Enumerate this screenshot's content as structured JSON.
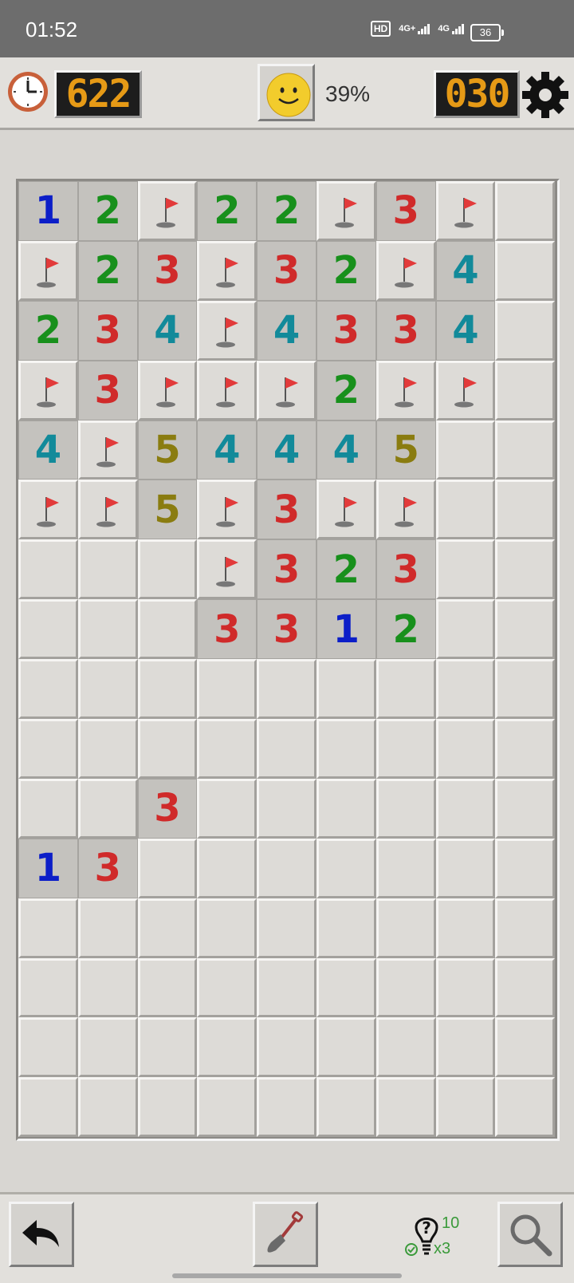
{
  "status_bar": {
    "time": "01:52",
    "hd": "HD",
    "net1": "4G+",
    "net2": "4G",
    "battery": "36"
  },
  "header": {
    "timer": "622",
    "progress": "39%",
    "mines_left": "030",
    "timer_icon": "clock-icon",
    "face_icon": "smiley-icon",
    "settings_icon": "gear-icon"
  },
  "board": {
    "columns": 9,
    "rows": [
      [
        "1",
        "2",
        "F",
        "2",
        "2",
        "F",
        "3",
        "F",
        ""
      ],
      [
        "F",
        "2",
        "3",
        "F",
        "3",
        "2",
        "F",
        "4",
        ""
      ],
      [
        "2",
        "3",
        "4",
        "F",
        "4",
        "3",
        "3",
        "4",
        ""
      ],
      [
        "F",
        "3",
        "F",
        "F",
        "F",
        "2",
        "F",
        "F",
        ""
      ],
      [
        "4",
        "F",
        "5",
        "4",
        "4",
        "4",
        "5",
        "",
        ""
      ],
      [
        "F",
        "F",
        "5",
        "F",
        "3",
        "F",
        "F",
        "",
        ""
      ],
      [
        "",
        "",
        "",
        "F",
        "3",
        "2",
        "3",
        "",
        ""
      ],
      [
        "",
        "",
        "",
        "3",
        "3",
        "1",
        "2",
        "",
        ""
      ],
      [
        "",
        "",
        "",
        "",
        "",
        "",
        "",
        "",
        ""
      ],
      [
        "",
        "",
        "",
        "",
        "",
        "",
        "",
        "",
        ""
      ],
      [
        "",
        "",
        "3",
        "",
        "",
        "",
        "",
        "",
        ""
      ],
      [
        "1",
        "3",
        "",
        "",
        "",
        "",
        "",
        "",
        ""
      ],
      [
        "",
        "",
        "",
        "",
        "",
        "",
        "",
        "",
        ""
      ],
      [
        "",
        "",
        "",
        "",
        "",
        "",
        "",
        "",
        ""
      ],
      [
        "",
        "",
        "",
        "",
        "",
        "",
        "",
        "",
        ""
      ],
      [
        "",
        "",
        "",
        "",
        "",
        "",
        "",
        "",
        ""
      ]
    ]
  },
  "toolbar": {
    "undo_icon": "undo-arrow-icon",
    "dig_icon": "shovel-icon",
    "hint_icon": "lightbulb-question-icon",
    "hints_available": "10",
    "hints_used": "x3",
    "search_icon": "magnifier-icon"
  },
  "colors": {
    "timer_digits": "#e69a16",
    "flag": "#e23a3a",
    "one": "#0c1ec8",
    "two": "#18901c",
    "three": "#d02a2a",
    "four": "#128a9a",
    "five": "#8a7c10"
  }
}
